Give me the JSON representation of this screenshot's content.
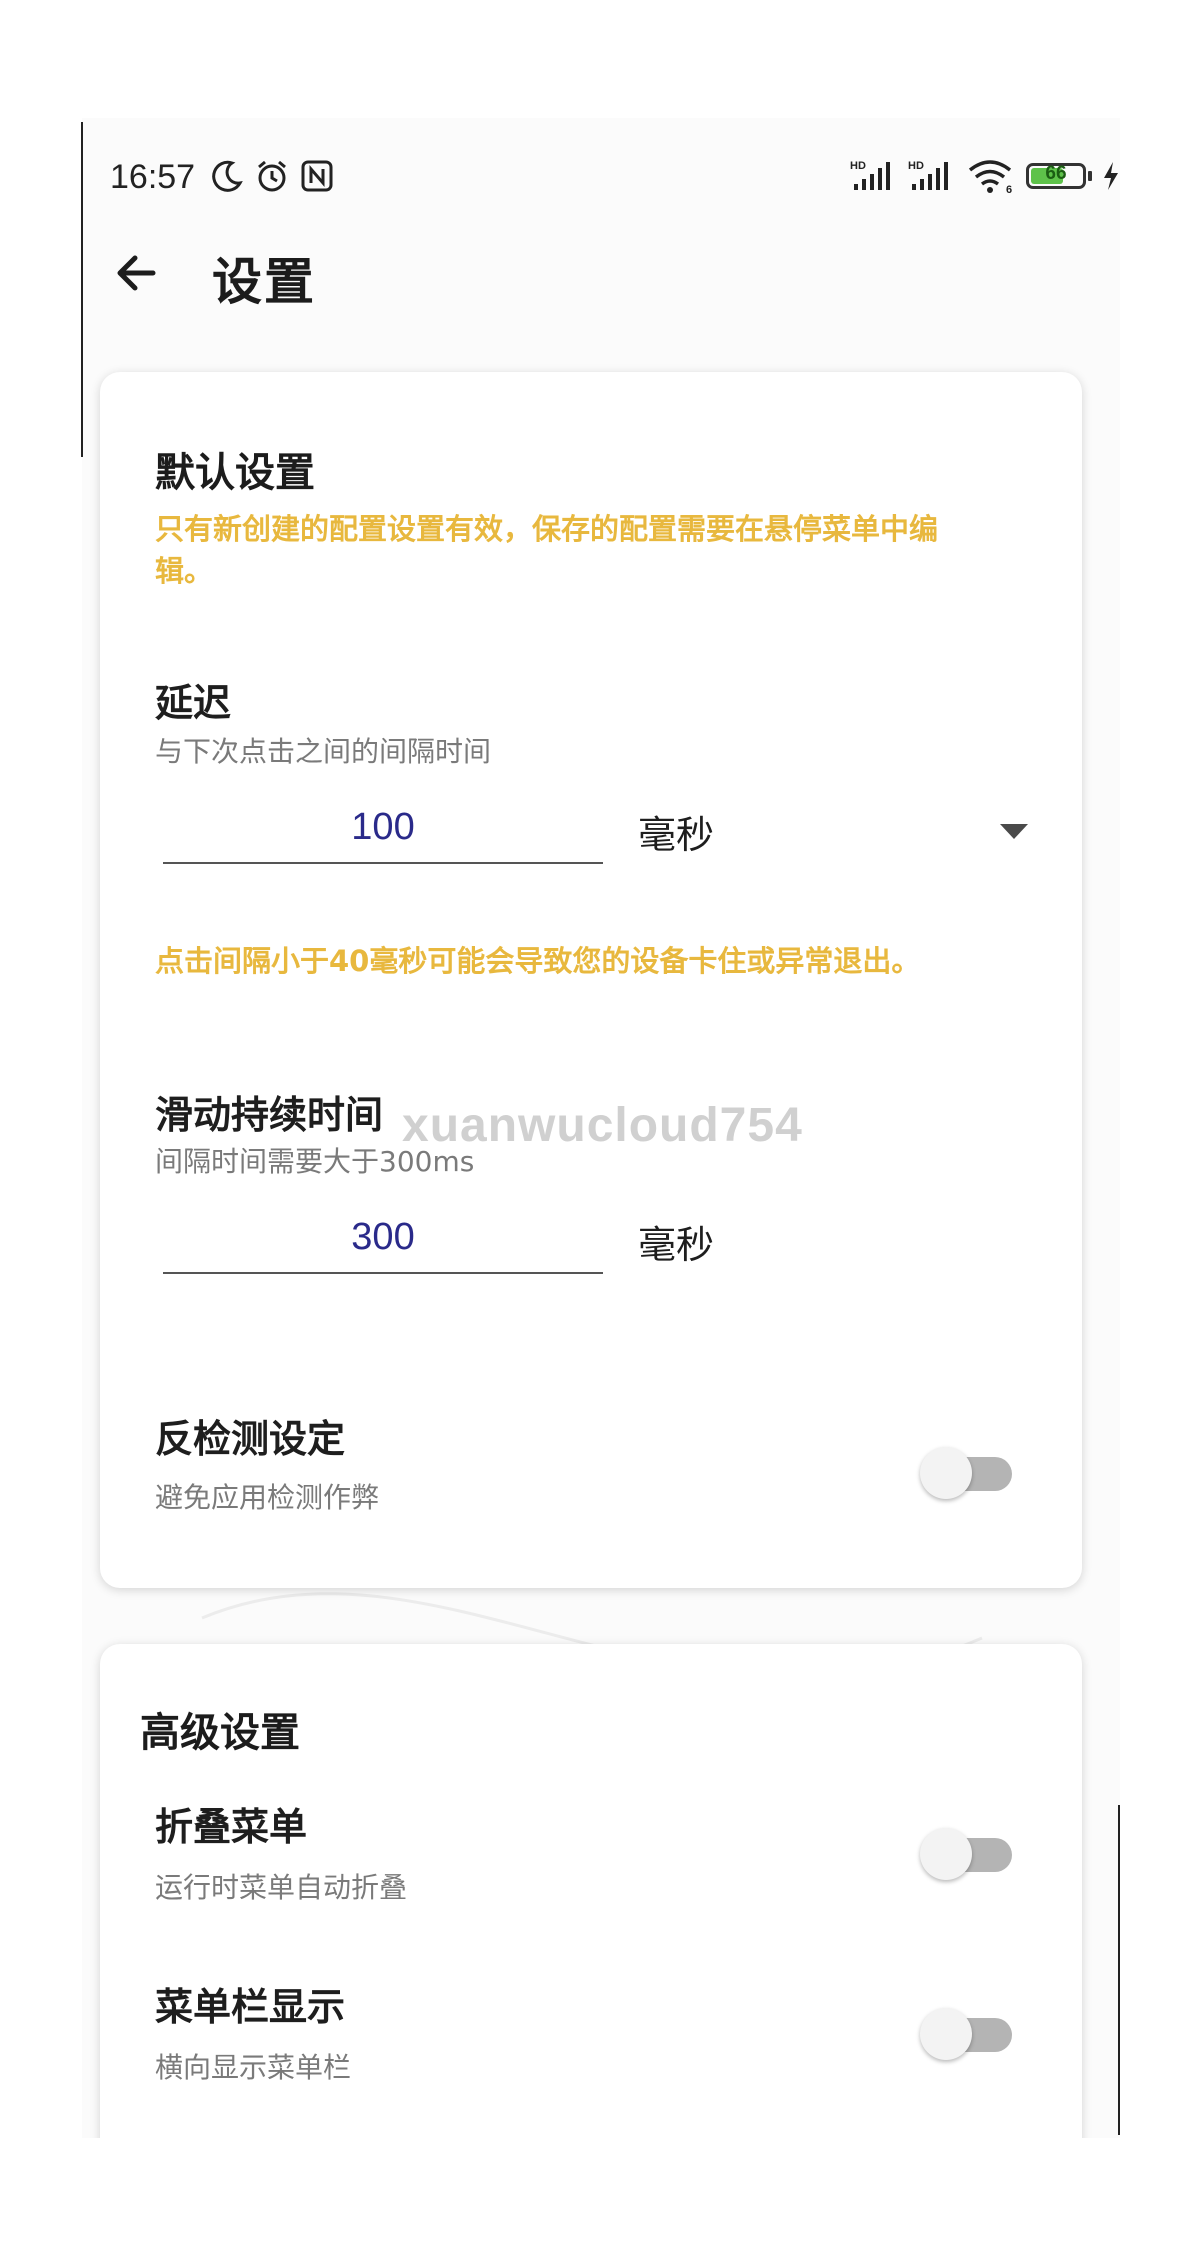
{
  "status_bar": {
    "time": "16:57",
    "icons_left": [
      "moon-icon",
      "alarm-icon",
      "nfc-icon"
    ],
    "icons_right": [
      "signal-hd-icon",
      "signal-hd-icon",
      "wifi-icon",
      "battery-icon",
      "charging-icon"
    ],
    "network_1": "HD",
    "network_2": "HD",
    "wifi_badge": "6",
    "battery_level": "66",
    "battery_color": "#5ec24a"
  },
  "app_bar": {
    "title": "设置",
    "back_icon": "arrow-left-icon"
  },
  "default_settings": {
    "title": "默认设置",
    "note_line1": "只有新创建的配置设置有效，保存的配置需要在悬停菜单中编",
    "note_line2": "辑。",
    "delay": {
      "title": "延迟",
      "subtitle": "与下次点击之间的间隔时间",
      "value": "100",
      "unit": "毫秒",
      "warning": "点击间隔小于40毫秒可能会导致您的设备卡住或异常退出。"
    },
    "swipe_duration": {
      "title": "滑动持续时间",
      "subtitle": "间隔时间需要大于300ms",
      "value": "300",
      "unit": "毫秒"
    },
    "anti_detection": {
      "title": "反检测设定",
      "subtitle": "避免应用检测作弊",
      "enabled": false
    }
  },
  "advanced_settings": {
    "title": "高级设置",
    "fold_menu": {
      "title": "折叠菜单",
      "subtitle": "运行时菜单自动折叠",
      "enabled": false
    },
    "menu_bar": {
      "title": "菜单栏显示",
      "subtitle": "横向显示菜单栏",
      "enabled": false
    }
  },
  "watermark": "xuanwucloud754",
  "colors": {
    "accent_note": "#e8b83e",
    "input_text": "#2a2a8a",
    "toggle_off_track": "#b4b4b4"
  }
}
